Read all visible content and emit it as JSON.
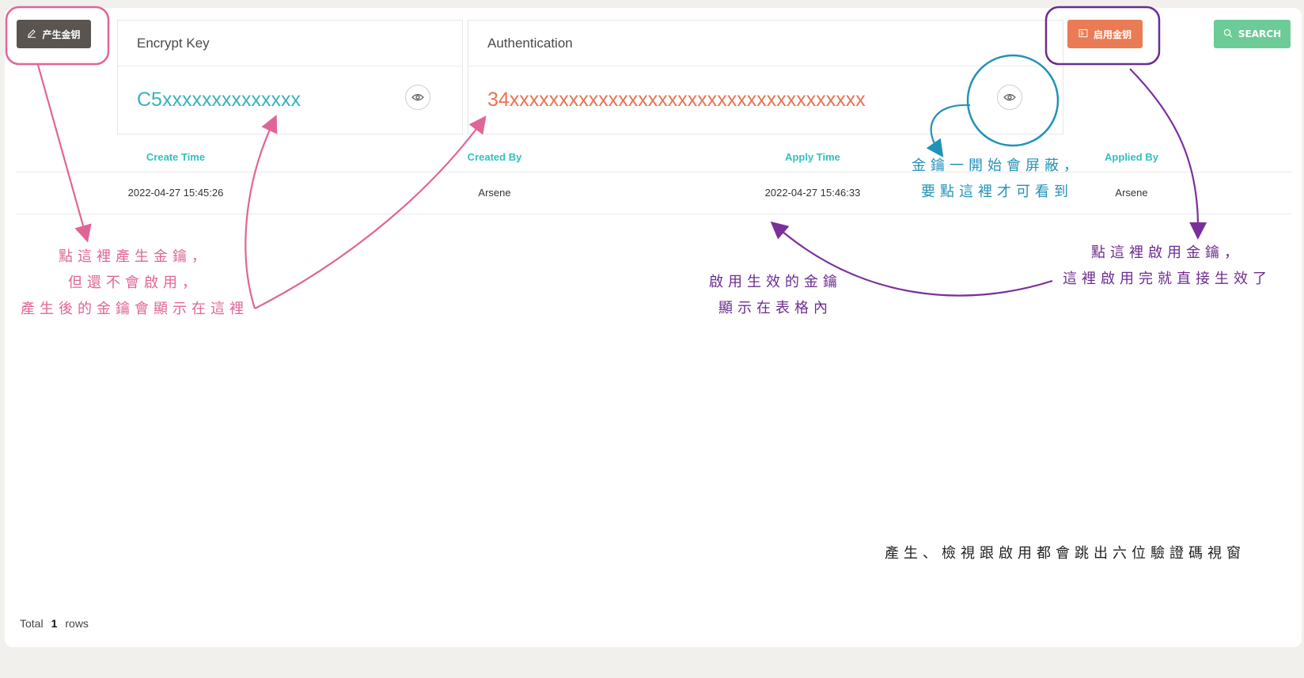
{
  "toolbar": {
    "generate_label": "产生金钥",
    "apply_label": "启用金钥",
    "search_label": "SEARCH"
  },
  "encrypt_key": {
    "title": "Encrypt Key",
    "value": "C5xxxxxxxxxxxxxx"
  },
  "authentication": {
    "title": "Authentication",
    "value": "34xxxxxxxxxxxxxxxxxxxxxxxxxxxxxxxxxxxx"
  },
  "table": {
    "columns": [
      "Create Time",
      "Created By",
      "Apply Time",
      "Applied By"
    ],
    "rows": [
      [
        "2022-04-27 15:45:26",
        "Arsene",
        "2022-04-27 15:46:33",
        "Arsene"
      ]
    ]
  },
  "footer": {
    "prefix": "Total",
    "count": "1",
    "suffix": "rows"
  },
  "annotations": {
    "generate": [
      "點這裡產生金鑰，",
      "但還不會啟用，",
      "產生後的金鑰會顯示在這裡"
    ],
    "apply": [
      "點這裡啟用金鑰，",
      "這裡啟用完就直接生效了"
    ],
    "table": [
      "啟用生效的金鑰",
      "顯示在表格內"
    ],
    "reveal": [
      "金鑰一開始會屏蔽，",
      "要點這裡才可看到"
    ],
    "note": "產生、檢視跟啟用都會跳出六位驗證碼視窗"
  },
  "colors": {
    "generate_button": "#595450",
    "apply_button": "#ea7b55",
    "search_button": "#6ccb96",
    "encrypt_value": "#35b3c0",
    "auth_value": "#e8734f",
    "column_header": "#33c0c2",
    "annotation_pink": "#e06597",
    "annotation_purple": "#6c2c8f",
    "annotation_teal": "#2392b8"
  }
}
